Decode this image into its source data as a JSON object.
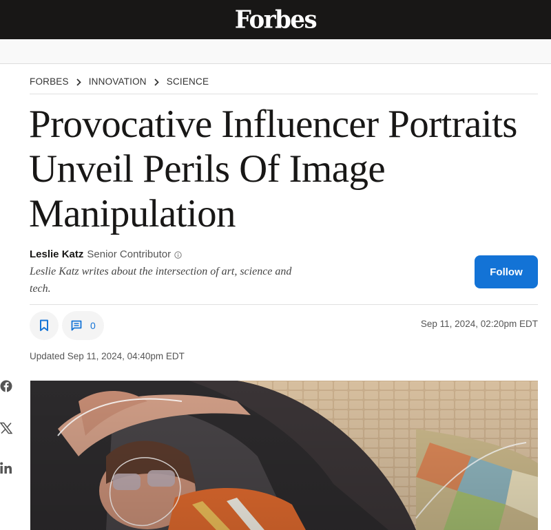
{
  "header": {
    "logo": "Forbes"
  },
  "breadcrumb": [
    "FORBES",
    "INNOVATION",
    "SCIENCE"
  ],
  "article": {
    "headline": "Provocative Influencer Portraits Unveil Perils Of Image Manipulation",
    "author": {
      "name": "Leslie Katz",
      "role": "Senior Contributor",
      "bio": "Leslie Katz writes about the intersection of art, science and tech."
    },
    "follow_label": "Follow",
    "comment_count": "0",
    "published": "Sep 11, 2024, 02:20pm EDT",
    "updated": "Updated Sep 11, 2024, 04:40pm EDT"
  },
  "social": [
    "facebook-icon",
    "x-icon",
    "linkedin-icon"
  ],
  "colors": {
    "topbar": "#181716",
    "accent": "#1373d6"
  }
}
